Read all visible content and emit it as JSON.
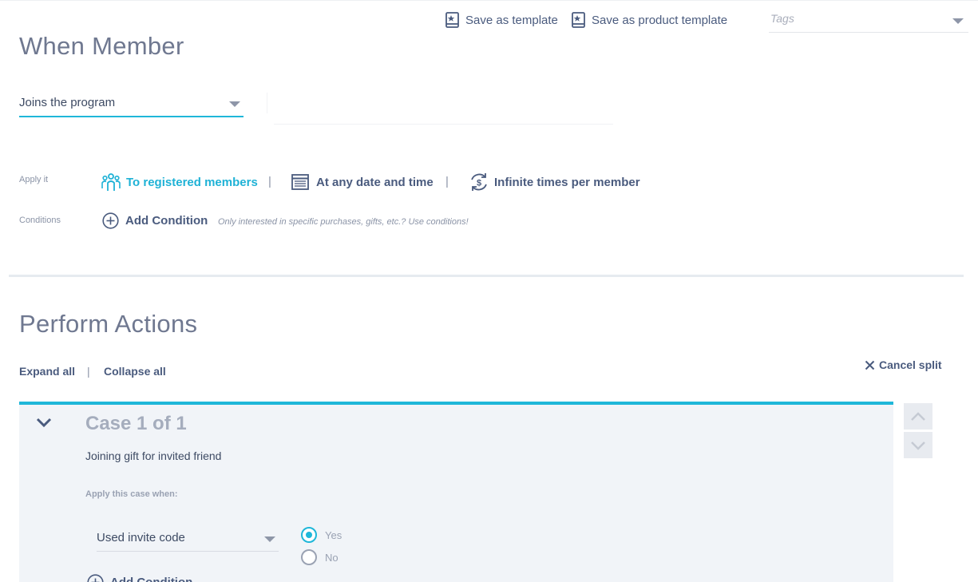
{
  "toolbar": {
    "save_template_label": "Save as template",
    "save_product_template_label": "Save as product template",
    "tags_placeholder": "Tags"
  },
  "when_member": {
    "title": "When Member",
    "trigger_value": "Joins the program"
  },
  "apply": {
    "label": "Apply it",
    "to_members": "To registered members",
    "date_time": "At any date and time",
    "times": "Infinite times per member",
    "separator": "|"
  },
  "conditions": {
    "label": "Conditions",
    "add_label": "Add Condition",
    "hint": "Only interested in specific purchases, gifts, etc.? Use conditions!"
  },
  "perform_actions": {
    "title": "Perform Actions",
    "expand_all": "Expand all",
    "collapse_all": "Collapse all",
    "separator": "|",
    "cancel_split": "Cancel split"
  },
  "case": {
    "title": "Case 1 of 1",
    "name": "Joining gift for invited friend",
    "apply_when_label": "Apply this case when:",
    "condition_value": "Used invite code",
    "radio_yes": "Yes",
    "radio_no": "No",
    "selected": "Yes",
    "add_condition": "Add Condition"
  },
  "colors": {
    "accent": "#1fb7d9",
    "navy": "#4a5b7e",
    "panel": "#f1f4f8"
  }
}
